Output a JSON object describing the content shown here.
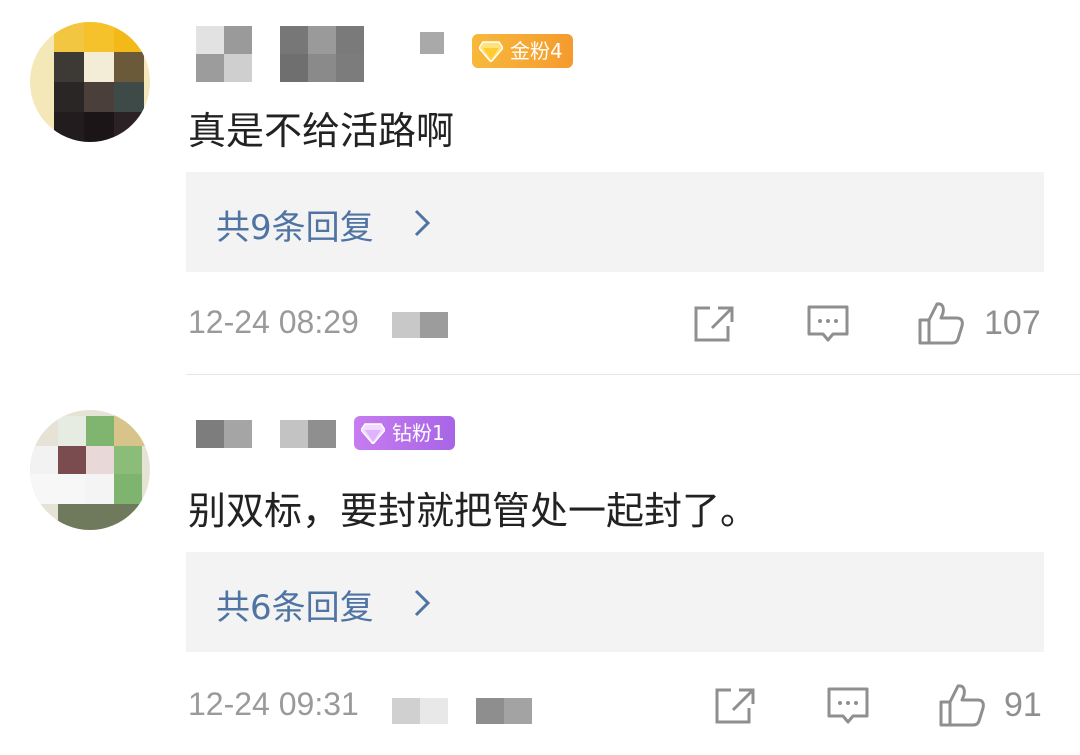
{
  "comments": [
    {
      "badge": "金粉4",
      "text": "真是不给活路啊",
      "replies_label": "共9条回复",
      "time": "12-24 08:29",
      "likes": "107",
      "icons": {
        "share": "share-icon",
        "comment": "comment-icon",
        "like": "thumbs-up-icon",
        "badge": "gem-icon"
      },
      "colors": {
        "badge": "#f5a623"
      }
    },
    {
      "badge": "钻粉1",
      "text": "别双标，要封就把管处一起封了。",
      "replies_label": "共6条回复",
      "time": "12-24 09:31",
      "likes": "91",
      "icons": {
        "share": "share-icon",
        "comment": "comment-icon",
        "like": "thumbs-up-icon",
        "badge": "diamond-icon"
      },
      "colors": {
        "badge": "#b36be8"
      }
    }
  ],
  "colors": {
    "reply_link": "#4f74a3",
    "meta": "#9a9a9a",
    "reply_bg": "#f3f3f3"
  }
}
